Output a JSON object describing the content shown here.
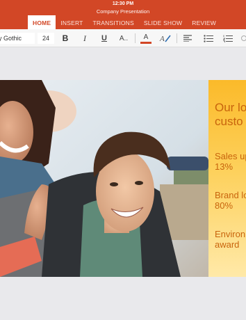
{
  "status": {
    "time": "12:30 PM"
  },
  "document": {
    "title": "Company Presentation"
  },
  "tabs": [
    {
      "label": "HOME",
      "active": true
    },
    {
      "label": "INSERT",
      "active": false
    },
    {
      "label": "TRANSITIONS",
      "active": false
    },
    {
      "label": "SLIDE SHOW",
      "active": false
    },
    {
      "label": "REVIEW",
      "active": false
    }
  ],
  "ribbon": {
    "font_name": "y Gothic",
    "font_size": "24",
    "bold_glyph": "B",
    "italic_glyph": "I",
    "underline_glyph": "U",
    "text_size_glyph": "A..",
    "font_color_glyph": "A",
    "highlight_glyph": "A",
    "colors": {
      "font_color_bar": "#d24726",
      "accent": "#d24726"
    }
  },
  "slide": {
    "heading_line1": "Our lo",
    "heading_line2": "custo",
    "stat1_line1": "Sales up",
    "stat1_line2": "13%",
    "stat2_line1": "Brand lo",
    "stat2_line2": "80%",
    "stat3_line1": "Environ",
    "stat3_line2": "award",
    "colors": {
      "panel": "#fbba2a",
      "panel_text": "#c8640d"
    }
  }
}
